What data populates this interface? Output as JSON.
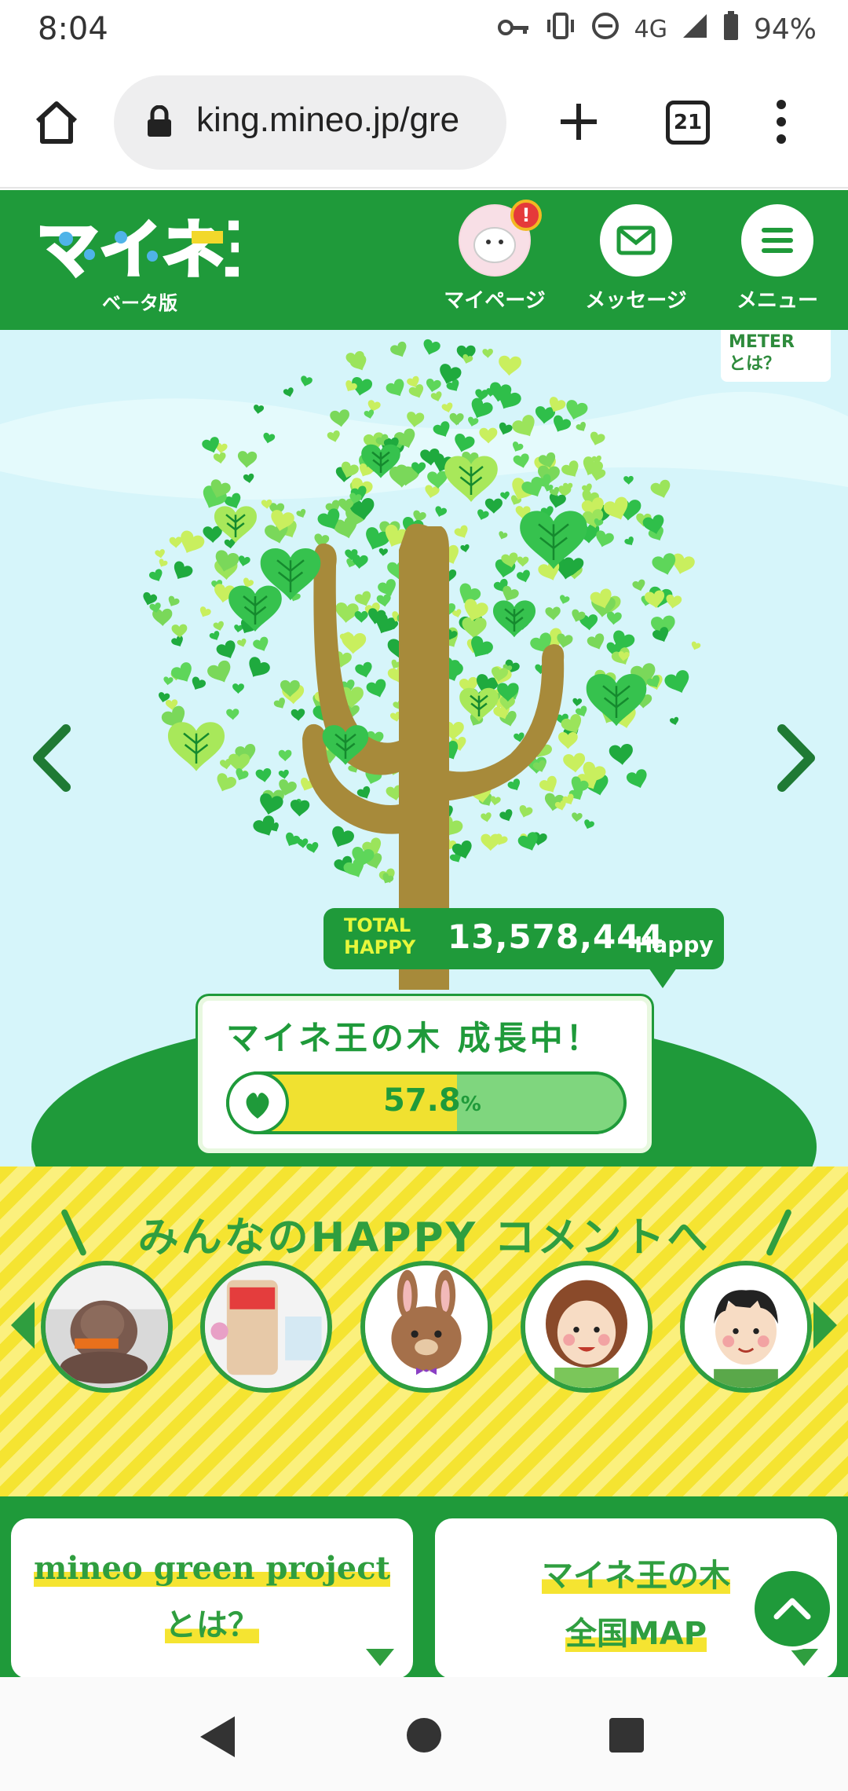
{
  "status_bar": {
    "time": "8:04",
    "network": "4G",
    "battery": "94%"
  },
  "browser": {
    "url": "king.mineo.jp/gre",
    "tab_count": "21"
  },
  "header": {
    "logo_text": "マイネ王",
    "logo_sub": "ベータ版",
    "mypage_label": "マイページ",
    "mypage_alert": "!",
    "message_label": "メッセージ",
    "menu_label": "メニュー"
  },
  "hero": {
    "meter_link_line1": "METER",
    "meter_link_line2": "とは？",
    "total_label_line1": "TOTAL",
    "total_label_line2": "HAPPY",
    "total_value": "13,578,444",
    "total_unit": "Happy",
    "growth_title": "マイネ王の木 成長中！",
    "progress_value": "57.8",
    "progress_unit": "%",
    "progress_fraction": 0.578
  },
  "comments": {
    "heading": "みんなのHAPPY コメントへ",
    "avatars": [
      {
        "name": "dog-photo"
      },
      {
        "name": "snack-photo"
      },
      {
        "name": "rabbit-illustration"
      },
      {
        "name": "woman-illustration"
      },
      {
        "name": "man-illustration"
      }
    ]
  },
  "cards": [
    {
      "line1": "mineo green project",
      "line2": "とは？"
    },
    {
      "line1": "マイネ王の木",
      "line2": "全国MAP"
    }
  ],
  "colors": {
    "brand_green": "#1f9a3a",
    "sky": "#d6f5fa",
    "yellow": "#f5e431"
  }
}
